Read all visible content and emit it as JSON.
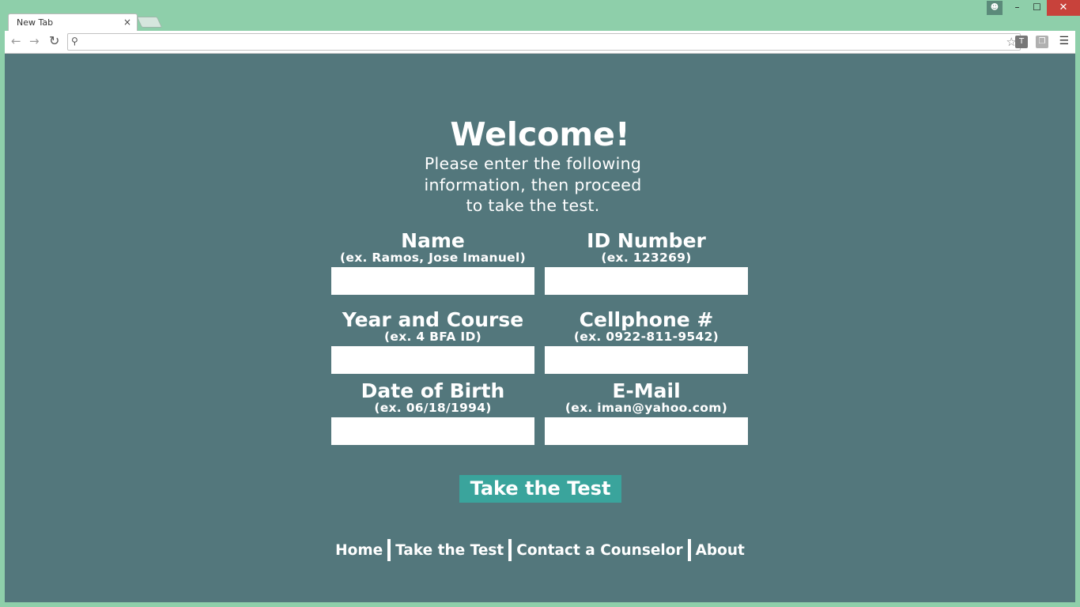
{
  "browser": {
    "tab_title": "New Tab",
    "tab_close": "×",
    "address_value": "",
    "extension_1": "T",
    "window_close": "✕",
    "window_minimize": "–",
    "window_maximize": "☐"
  },
  "page": {
    "heading": "Welcome!",
    "intro_line1": "Please enter the following",
    "intro_line2": "information, then proceed",
    "intro_line3": "to take the test.",
    "fields": [
      {
        "label": "Name",
        "hint": "(ex. Ramos, Jose Imanuel)",
        "value": ""
      },
      {
        "label": "ID Number",
        "hint": "(ex. 123269)",
        "value": ""
      },
      {
        "label": "Year and Course",
        "hint": "(ex. 4 BFA ID)",
        "value": ""
      },
      {
        "label": "Cellphone #",
        "hint": "(ex. 0922-811-9542)",
        "value": ""
      },
      {
        "label": "Date of Birth",
        "hint": "(ex. 06/18/1994)",
        "value": ""
      },
      {
        "label": "E-Mail",
        "hint": "(ex. iman@yahoo.com)",
        "value": ""
      }
    ],
    "submit_label": "Take the Test",
    "nav": [
      "Home",
      "Take the Test",
      "Contact a Counselor",
      "About"
    ]
  },
  "colors": {
    "frame": "#8ecfaa",
    "page_bg": "#53777c",
    "button_bg": "#3aa49c",
    "text": "#ffffff"
  }
}
